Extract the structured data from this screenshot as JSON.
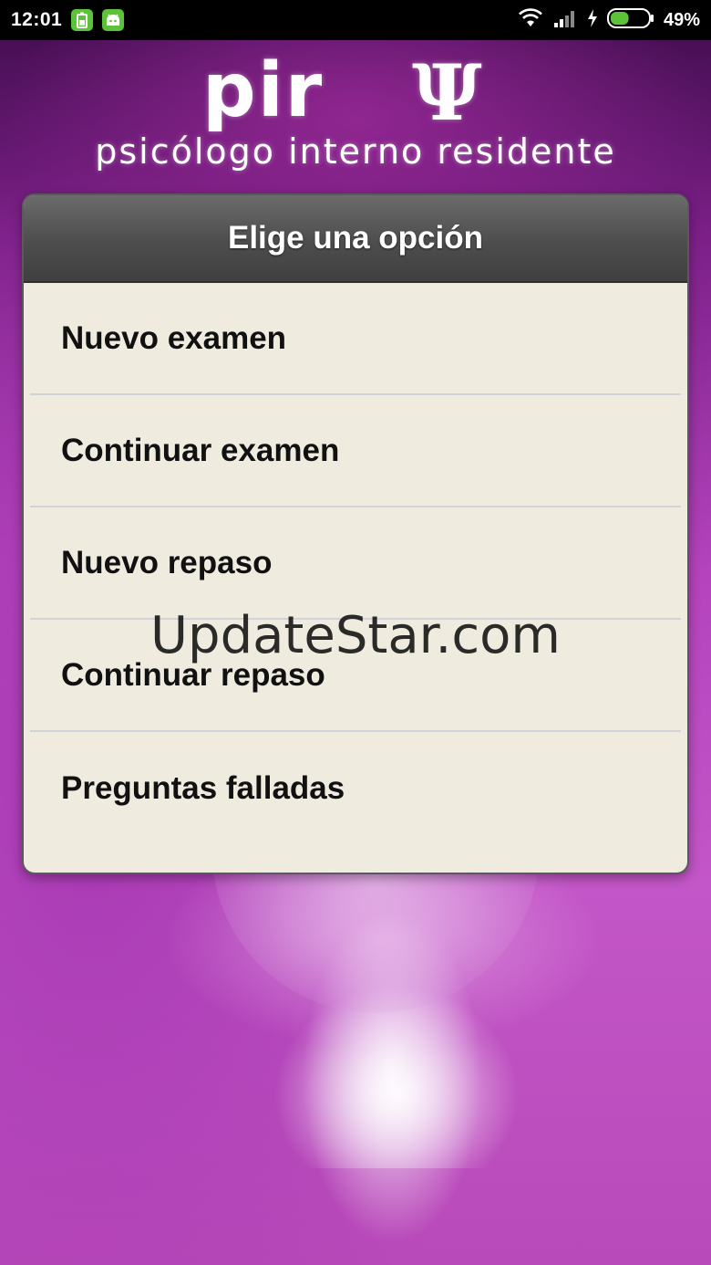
{
  "status_bar": {
    "time": "12:01",
    "battery_percent": "49%",
    "battery_level": 0.49,
    "icons": [
      "battery-notif-icon",
      "android-notif-icon",
      "wifi-icon",
      "signal-icon",
      "charging-icon",
      "battery-icon"
    ]
  },
  "logo": {
    "pir": "pir",
    "psi": "Ψ",
    "subtitle": "psicólogo interno residente"
  },
  "dialog": {
    "title": "Elige una opción",
    "options": [
      {
        "label": "Nuevo examen"
      },
      {
        "label": "Continuar examen"
      },
      {
        "label": "Nuevo repaso"
      },
      {
        "label": "Continuar repaso"
      },
      {
        "label": "Preguntas falladas"
      }
    ]
  },
  "watermark": "UpdateStar.com",
  "colors": {
    "dialog_bg": "#f0ebdf",
    "header_bg": "#4d4d4d",
    "background_accent": "#b443bd",
    "battery_green": "#5cc23a"
  }
}
